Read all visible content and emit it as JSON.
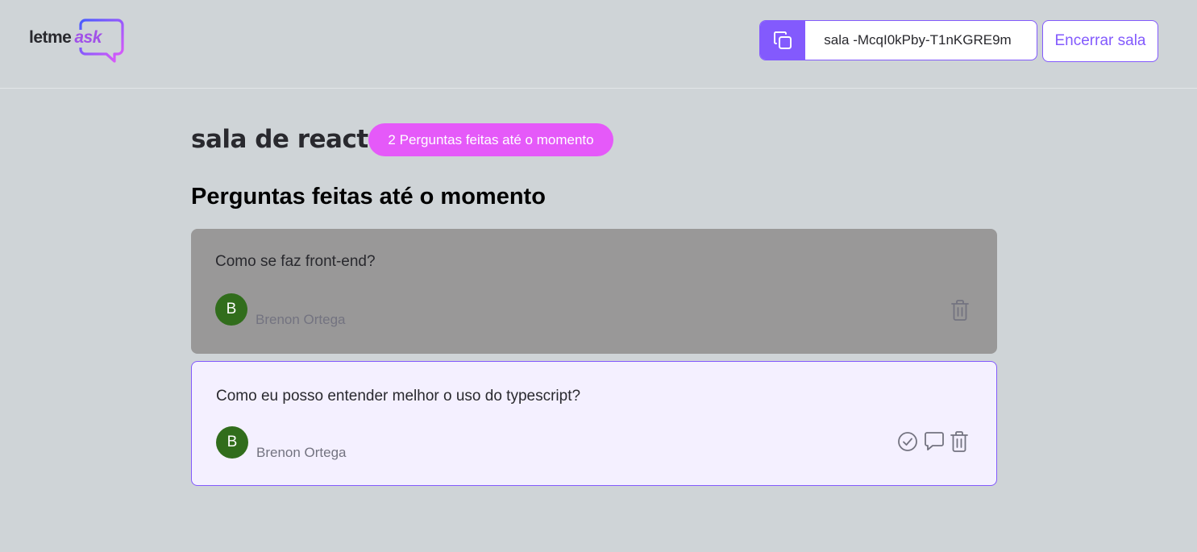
{
  "header": {
    "logo": {
      "part1": "letme",
      "part2": "ask"
    },
    "room_code": {
      "text": "sala -McqI0kPby-T1nKGRE9m",
      "icon": "copy-icon"
    },
    "end_room_label": "Encerrar sala"
  },
  "room": {
    "title": "sala de react",
    "question_count_label": "2 Perguntas feitas até o momento",
    "section_title": "Perguntas feitas até o momento"
  },
  "questions": [
    {
      "content": "Como se faz front-end?",
      "author_initial": "B",
      "author_name": "Brenon Ortega",
      "state": "answered",
      "actions": [
        "trash-icon"
      ]
    },
    {
      "content": "Como eu posso entender melhor o uso do typescript?",
      "author_initial": "B",
      "author_name": "Brenon Ortega",
      "state": "highlighted",
      "actions": [
        "check-circle-icon",
        "chat-bubble-icon",
        "trash-icon"
      ]
    }
  ],
  "colors": {
    "background": "#cfd4d7",
    "accent": "#835afd",
    "badge": "#e559f9",
    "answered_bg": "#999898",
    "highlighted_bg": "#f4f0ff",
    "avatar": "#316d1c"
  }
}
